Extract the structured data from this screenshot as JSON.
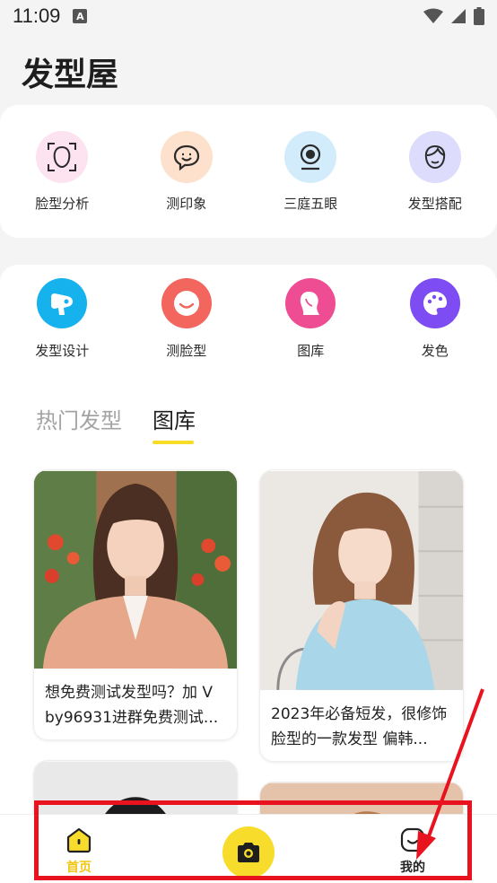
{
  "status_bar": {
    "time": "11:09",
    "notification_letter": "A"
  },
  "app": {
    "title": "发型屋"
  },
  "features_primary": [
    {
      "label": "脸型分析",
      "icon": "face-scan-icon",
      "color": "#fde3ef"
    },
    {
      "label": "测印象",
      "icon": "chat-smile-icon",
      "color": "#fde1cc"
    },
    {
      "label": "三庭五眼",
      "icon": "webcam-icon",
      "color": "#d3ecfb"
    },
    {
      "label": "发型搭配",
      "icon": "hair-face-icon",
      "color": "#dddcfc"
    }
  ],
  "features_secondary": [
    {
      "label": "发型设计",
      "icon": "hair-dryer-icon",
      "color": "#16b2ee"
    },
    {
      "label": "测脸型",
      "icon": "smile-face-icon",
      "color": "#f2665e"
    },
    {
      "label": "图库",
      "icon": "woman-profile-icon",
      "color": "#ee4d93"
    },
    {
      "label": "发色",
      "icon": "palette-icon",
      "color": "#7d4cf2"
    }
  ],
  "tabs": [
    {
      "label": "热门发型",
      "active": false
    },
    {
      "label": "图库",
      "active": true
    }
  ],
  "posts": [
    {
      "text": "想免费测试发型吗？加 V by96931进群免费测试..."
    },
    {
      "text": "2023年必备短发，很修饰脸型的一款发型 偏韩..."
    },
    {
      "text": ""
    },
    {
      "text": ""
    }
  ],
  "bottom_nav": {
    "home_label": "首页",
    "mine_label": "我的",
    "active_color": "#f2c511"
  },
  "colors": {
    "accent_yellow": "#f7dc28",
    "annotation_red": "#e8131e"
  }
}
